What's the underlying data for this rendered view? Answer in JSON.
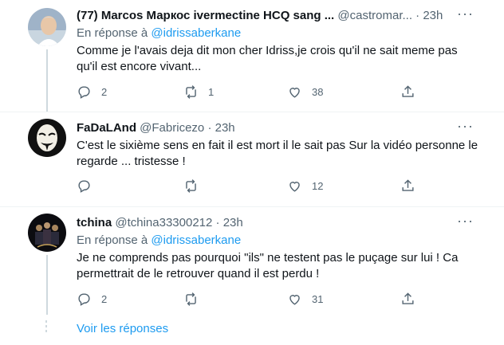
{
  "tweets": [
    {
      "name": "(77) Marcos Маркос ivermectine HCQ sang ...",
      "handle": "@castromar...",
      "dot": "·",
      "time": "23h",
      "reply_prefix": "En réponse à",
      "reply_to": "@idrissaberkane",
      "text_line1": "Comme je l'avais deja dit mon cher Idriss,je crois qu'il ne sait meme pas",
      "text_line2": "qu'il est encore vivant...",
      "replies": "2",
      "retweets": "1",
      "likes": "38"
    },
    {
      "name": "FaDaLAnd",
      "handle": "@Fabricezo",
      "dot": "·",
      "time": "23h",
      "text_line1": "C'est le sixième sens en fait il est mort il le sait pas Sur la vidéo personne le",
      "text_line2": "regarde ... tristesse !",
      "replies": "",
      "retweets": "",
      "likes": "12"
    },
    {
      "name": "tchina",
      "handle": "@tchina33300212",
      "dot": "·",
      "time": "23h",
      "reply_prefix": "En réponse à",
      "reply_to": "@idrissaberkane",
      "text_line1": "Je ne comprends pas pourquoi \"ils\" ne testent pas le puçage sur lui ! Ca",
      "text_line2": "permettrait de le retrouver quand il est perdu !",
      "replies": "2",
      "retweets": "",
      "likes": "31"
    }
  ],
  "show_replies": "Voir les réponses",
  "more_glyph": "···"
}
